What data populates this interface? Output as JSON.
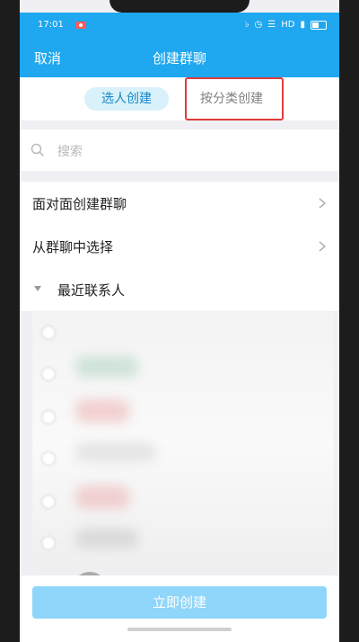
{
  "status_bar": {
    "time": "17:01",
    "network": "HD"
  },
  "header": {
    "cancel_label": "取消",
    "title": "创建群聊"
  },
  "tabs": [
    {
      "label": "选人创建"
    },
    {
      "label": "按分类创建"
    }
  ],
  "search": {
    "placeholder": "搜索"
  },
  "list": {
    "items": [
      {
        "label": "面对面创建群聊"
      },
      {
        "label": "从群聊中选择"
      }
    ],
    "recent_contacts_header": "最近联系人"
  },
  "footer": {
    "create_button_label": "立即创建"
  },
  "colors": {
    "accent": "#1fa7ef",
    "button": "#8fd6fa",
    "highlight": "#e23a3a"
  }
}
